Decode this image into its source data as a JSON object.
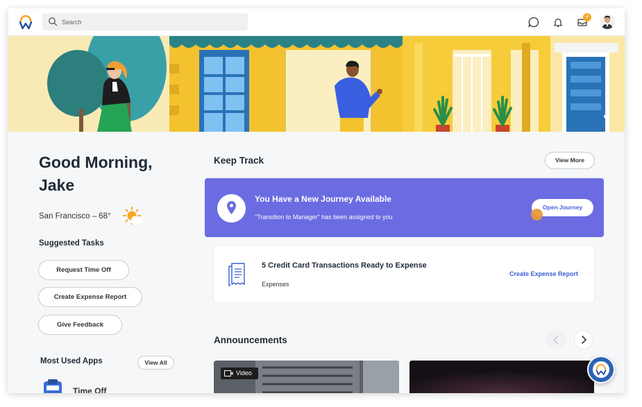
{
  "header": {
    "logo": "workday-logo",
    "search": {
      "placeholder": "Search",
      "value": ""
    },
    "icons": [
      "chat-icon",
      "notification-bell-icon",
      "inbox-icon"
    ],
    "inbox_badge": "4",
    "avatar": "user-avatar"
  },
  "greeting": {
    "line": "Good Morning, Jake"
  },
  "weather": {
    "text": "San Francisco – 68°",
    "icon": "partly-sunny-icon"
  },
  "suggested_tasks": {
    "title": "Suggested Tasks",
    "items": [
      "Request Time Off",
      "Create Expense Report",
      "Give Feedback"
    ]
  },
  "most_used_apps": {
    "title": "Most Used Apps",
    "view_all": "View All",
    "apps": [
      {
        "label": "Time Off",
        "icon": "time-off-icon"
      }
    ]
  },
  "keep_track": {
    "title": "Keep Track",
    "view_more": "View More",
    "journey": {
      "title": "You Have a New Journey Available",
      "subtitle": "\"Transition to Manager\" has been assigned to you",
      "button": "Open Journey",
      "icon": "location-pin-icon"
    },
    "expense": {
      "title": "5 Credit Card Transactions Ready to Expense",
      "subtitle": "Expenses",
      "link": "Create Expense Report",
      "icon": "receipt-icon"
    }
  },
  "announcements": {
    "title": "Announcements",
    "cards": [
      {
        "tag": "Video"
      },
      {
        "tag": ""
      }
    ]
  },
  "colors": {
    "journey_banner": "#6b6ce2",
    "link_blue": "#3a5fd4",
    "brand_orange": "#f5a623",
    "brand_blue": "#2a63b6"
  }
}
